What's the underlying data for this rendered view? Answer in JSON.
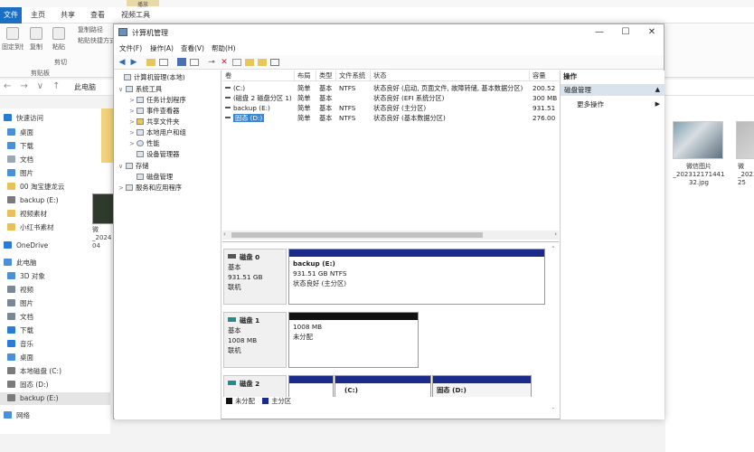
{
  "explorer": {
    "context_tab": "播放",
    "file_tab": "文件",
    "tabs": [
      "主页",
      "共享",
      "查看",
      "视频工具"
    ],
    "ribbon": {
      "pin_label": "固定到快速访问",
      "copy_label": "复制",
      "paste_label": "粘贴",
      "copy_path_label": "复制路径",
      "paste_shortcut_label": "粘贴快捷方式",
      "cut_label": "剪切",
      "clipboard_group": "剪贴板"
    },
    "address": "此电脑",
    "nav": [
      {
        "label": "快速访问",
        "icon": "star-icon",
        "color": "#2a7bd6"
      },
      {
        "label": "桌面",
        "icon": "desktop-icon",
        "color": "#4a90d9"
      },
      {
        "label": "下载",
        "icon": "download-icon",
        "color": "#4a90d9"
      },
      {
        "label": "文档",
        "icon": "document-icon",
        "color": "#9aa7b5"
      },
      {
        "label": "图片",
        "icon": "pictures-icon",
        "color": "#4a90d9"
      },
      {
        "label": "00 淘宝捷龙云",
        "icon": "folder-icon",
        "color": "#e8c15a"
      },
      {
        "label": "backup (E:)",
        "icon": "drive-icon",
        "color": "#7a7a7a"
      },
      {
        "label": "视频素材",
        "icon": "folder-icon",
        "color": "#e8c15a"
      },
      {
        "label": "小红书素材",
        "icon": "folder-icon",
        "color": "#e8c15a"
      },
      {
        "label": "OneDrive",
        "icon": "cloud-icon",
        "color": "#2a7bd6"
      },
      {
        "label": "此电脑",
        "icon": "computer-icon",
        "color": "#4a90d9"
      },
      {
        "label": "3D 对象",
        "icon": "cube-icon",
        "color": "#4a90d9"
      },
      {
        "label": "视频",
        "icon": "video-icon",
        "color": "#7a8795"
      },
      {
        "label": "图片",
        "icon": "pictures-icon",
        "color": "#7a8795"
      },
      {
        "label": "文档",
        "icon": "document-icon",
        "color": "#7a8795"
      },
      {
        "label": "下载",
        "icon": "download-icon",
        "color": "#2a7bd6"
      },
      {
        "label": "音乐",
        "icon": "music-icon",
        "color": "#2a7bd6"
      },
      {
        "label": "桌面",
        "icon": "desktop-icon",
        "color": "#4a90d9"
      },
      {
        "label": "本地磁盘 (C:)",
        "icon": "drive-icon",
        "color": "#7a7a7a"
      },
      {
        "label": "固态 (D:)",
        "icon": "drive-icon",
        "color": "#7a7a7a"
      },
      {
        "label": "backup (E:)",
        "icon": "drive-icon",
        "color": "#7a7a7a"
      },
      {
        "label": "网络",
        "icon": "network-icon",
        "color": "#4a90d9"
      }
    ],
    "mid_caption": "微\n_2024\n04",
    "thumbs": [
      {
        "caption": "微信图片\n_202312171441\n32.jpg"
      },
      {
        "caption": "微\n_2023\n25"
      }
    ]
  },
  "cm": {
    "title": "计算机管理",
    "window_buttons": {
      "minimize": "—",
      "maximize": "☐",
      "close": "✕"
    },
    "menu": [
      "文件(F)",
      "操作(A)",
      "查看(V)",
      "帮助(H)"
    ],
    "tree": [
      {
        "label": "计算机管理(本地)",
        "twisty": ""
      },
      {
        "label": "系统工具",
        "twisty": "∨"
      },
      {
        "label": "任务计划程序",
        "twisty": ">"
      },
      {
        "label": "事件查看器",
        "twisty": ">"
      },
      {
        "label": "共享文件夹",
        "twisty": ">"
      },
      {
        "label": "本地用户和组",
        "twisty": ">"
      },
      {
        "label": "性能",
        "twisty": ">"
      },
      {
        "label": "设备管理器",
        "twisty": ""
      },
      {
        "label": "存储",
        "twisty": "∨"
      },
      {
        "label": "磁盘管理",
        "twisty": ""
      },
      {
        "label": "服务和应用程序",
        "twisty": ">"
      }
    ],
    "volume_headers": [
      "卷",
      "布局",
      "类型",
      "文件系统",
      "状态",
      "容量"
    ],
    "volumes": [
      {
        "name": "(C:)",
        "layout": "简单",
        "type": "基本",
        "fs": "NTFS",
        "status": "状态良好 (启动, 页面文件, 故障转储, 基本数据分区)",
        "capacity": "200.52"
      },
      {
        "name": "(磁盘 2 磁盘分区 1)",
        "layout": "简单",
        "type": "基本",
        "fs": "",
        "status": "状态良好 (EFI 系统分区)",
        "capacity": "300 MB"
      },
      {
        "name": "backup (E:)",
        "layout": "简单",
        "type": "基本",
        "fs": "NTFS",
        "status": "状态良好 (主分区)",
        "capacity": "931.51"
      },
      {
        "name": "固态 (D:)",
        "layout": "简单",
        "type": "基本",
        "fs": "NTFS",
        "status": "状态良好 (基本数据分区)",
        "capacity": "276.00"
      }
    ],
    "disks": [
      {
        "name": "磁盘 0",
        "type": "基本",
        "size": "931.51 GB",
        "state": "联机",
        "partitions": [
          {
            "name": "backup  (E:)",
            "line2": "931.51 GB NTFS",
            "line3": "状态良好 (主分区)"
          }
        ]
      },
      {
        "name": "磁盘 1",
        "type": "基本",
        "size": "1008 MB",
        "state": "联机",
        "partitions": [
          {
            "name": "",
            "line2": "1008 MB",
            "line3": "未分配"
          }
        ]
      },
      {
        "name": "磁盘 2",
        "partitions": [
          {
            "name": ""
          },
          {
            "name": "(C:)"
          },
          {
            "name": "固态  (D:)"
          }
        ]
      }
    ],
    "legend": {
      "unallocated": "未分配",
      "primary": "主分区",
      "unallocated_color": "#111111",
      "primary_color": "#1c2a8a"
    },
    "actions": {
      "header": "操作",
      "section": "磁盘管理",
      "more": "更多操作"
    }
  }
}
